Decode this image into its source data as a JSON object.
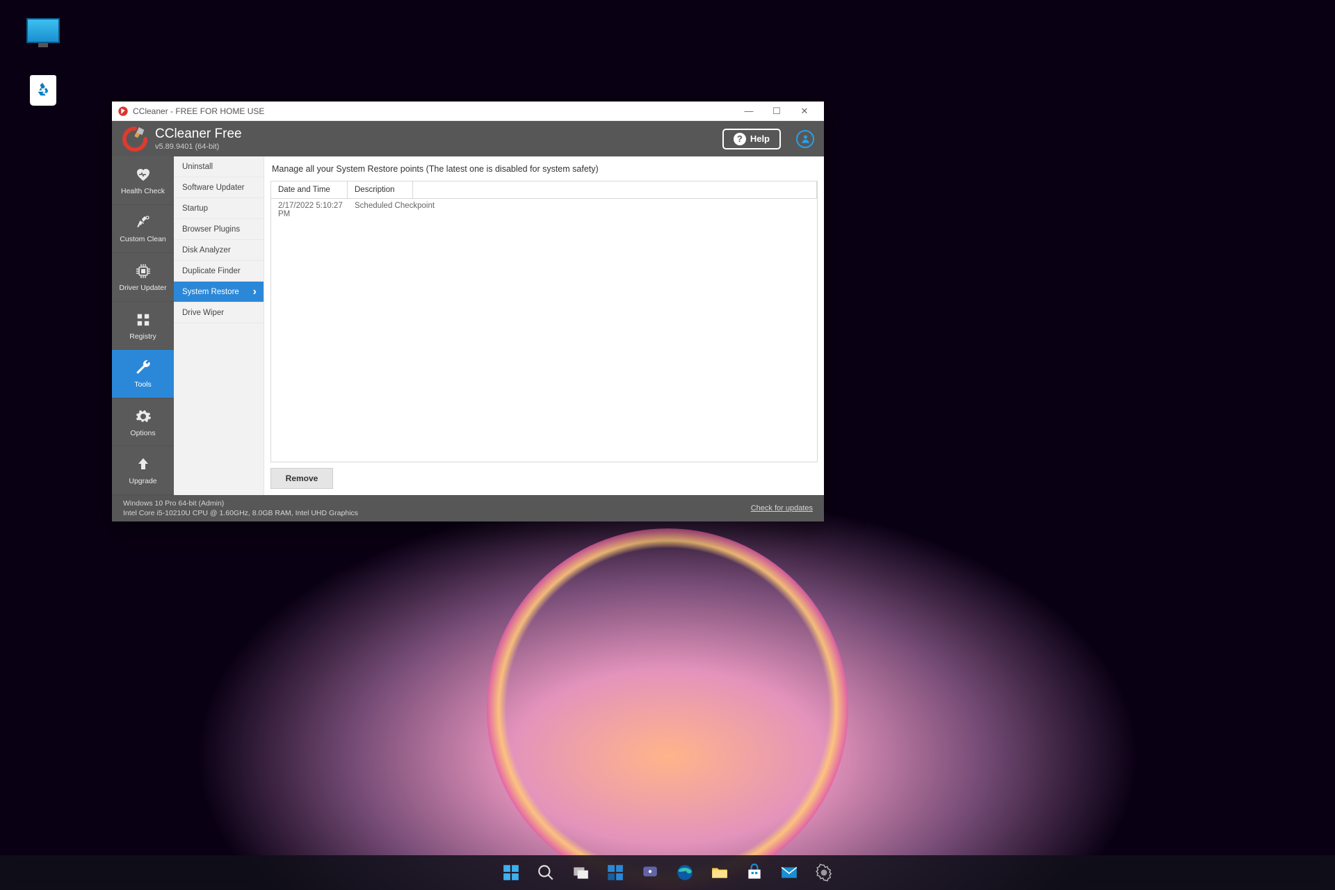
{
  "desktop": {
    "icons": [
      {
        "name": "this-pc"
      },
      {
        "name": "recycle-bin"
      }
    ]
  },
  "window": {
    "titlebar": "CCleaner - FREE FOR HOME USE",
    "app_name": "CCleaner Free",
    "version": "v5.89.9401 (64-bit)",
    "help_label": "Help"
  },
  "sidebar": {
    "items": [
      {
        "label": "Health Check"
      },
      {
        "label": "Custom Clean"
      },
      {
        "label": "Driver Updater"
      },
      {
        "label": "Registry"
      },
      {
        "label": "Tools"
      },
      {
        "label": "Options"
      },
      {
        "label": "Upgrade"
      }
    ],
    "active": 4
  },
  "subnav": {
    "items": [
      "Uninstall",
      "Software Updater",
      "Startup",
      "Browser Plugins",
      "Disk Analyzer",
      "Duplicate Finder",
      "System Restore",
      "Drive Wiper"
    ],
    "active": 6
  },
  "main": {
    "description": "Manage all your System Restore points (The latest one is disabled for system safety)",
    "columns": {
      "c1": "Date and Time",
      "c2": "Description"
    },
    "rows": [
      {
        "datetime": "2/17/2022 5:10:27 PM",
        "desc": "Scheduled Checkpoint"
      }
    ],
    "remove_label": "Remove"
  },
  "footer": {
    "line1": "Windows 10 Pro 64-bit (Admin)",
    "line2": "Intel Core i5-10210U CPU @ 1.60GHz, 8.0GB RAM, Intel UHD Graphics",
    "updates": "Check for updates"
  },
  "taskbar": {
    "items": [
      "start",
      "search",
      "task-view",
      "widgets",
      "chat",
      "edge",
      "explorer",
      "store",
      "mail",
      "settings"
    ]
  }
}
